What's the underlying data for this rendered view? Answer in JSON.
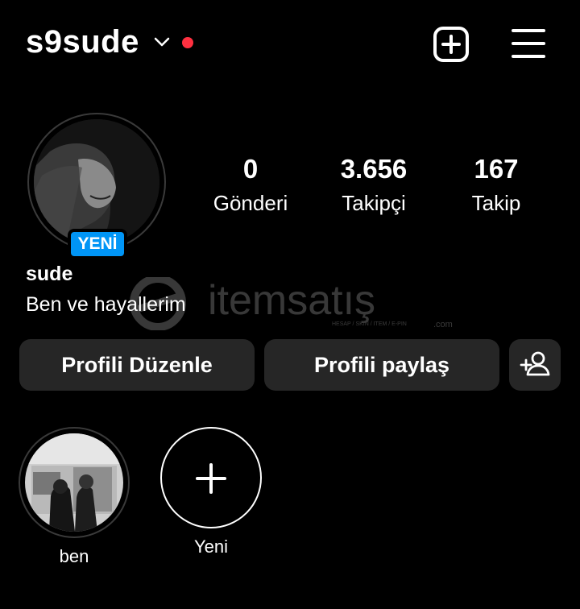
{
  "header": {
    "username": "s9sude",
    "icons": {
      "dropdown": "chevron-down-icon",
      "notification": "red-dot",
      "add": "add-post-icon",
      "menu": "hamburger-menu-icon"
    },
    "notification_color": "#ff3040"
  },
  "profile": {
    "new_badge": "YENİ",
    "name": "sude",
    "bio": "Ben ve hayallerim",
    "badge_color": "#0095f6"
  },
  "stats": [
    {
      "value": "0",
      "label": "Gönderi"
    },
    {
      "value": "3.656",
      "label": "Takipçi"
    },
    {
      "value": "167",
      "label": "Takip"
    }
  ],
  "watermark": {
    "brand": "itemsatış",
    "sub": "HESAP / SKIN / ITEM / E-PIN",
    "tld": ".com"
  },
  "buttons": {
    "edit_profile": "Profili Düzenle",
    "share_profile": "Profili paylaş",
    "discover_people_icon": "add-person-icon"
  },
  "highlights": [
    {
      "label": "ben"
    },
    {
      "label": "Yeni"
    }
  ]
}
